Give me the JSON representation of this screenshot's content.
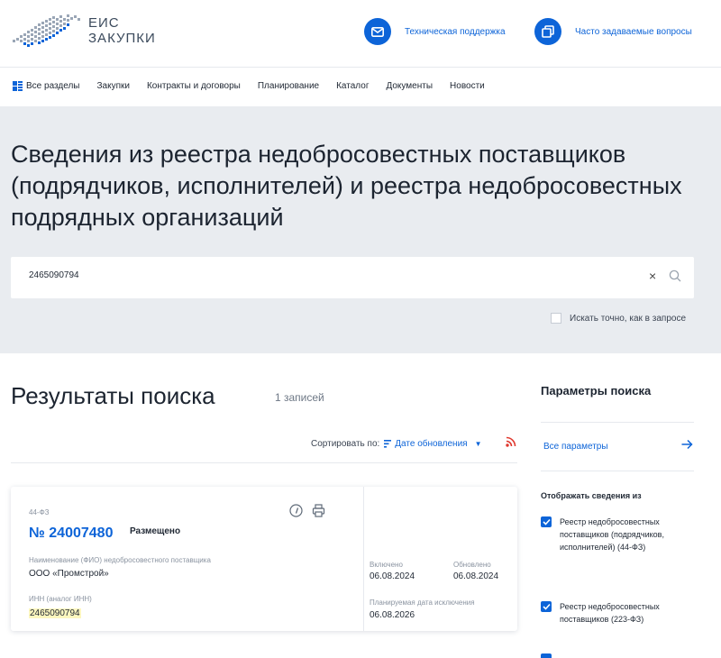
{
  "header": {
    "logo_line1": "ЕИС",
    "logo_line2": "ЗАКУПКИ",
    "support_label": "Техническая поддержка",
    "faq_label": "Часто задаваемые вопросы"
  },
  "nav": {
    "all_sections": "Все разделы",
    "items": [
      "Закупки",
      "Контракты и договоры",
      "Планирование",
      "Каталог",
      "Документы",
      "Новости"
    ]
  },
  "hero": {
    "title": "Сведения из реестра недобросовестных поставщиков (подрядчиков, исполнителей) и реестра недобросовестных подрядных организаций",
    "search_value": "2465090794",
    "exact_label": "Искать точно, как в запросе"
  },
  "results": {
    "title": "Результаты поиска",
    "count": "1 записей",
    "sort_label": "Сортировать по:",
    "sort_value": "Дате обновления"
  },
  "card": {
    "law": "44-ФЗ",
    "number": "№ 24007480",
    "status": "Размещено",
    "supplier_label": "Наименование (ФИО) недобросовестного поставщика",
    "supplier_value": "ООО «Промстрой»",
    "inn_label": "ИНН (аналог ИНН)",
    "inn_value": "2465090794",
    "included_label": "Включено",
    "included_value": "06.08.2024",
    "updated_label": "Обновлено",
    "updated_value": "06.08.2024",
    "planned_label": "Планируемая дата исключения",
    "planned_value": "06.08.2026"
  },
  "panel": {
    "title": "Параметры поиска",
    "all_params": "Все параметры",
    "show_from": "Отображать сведения из",
    "options": [
      "Реестр недобросовестных поставщиков (подрядчиков, исполнителей) (44-ФЗ)",
      "Реестр недобросовестных поставщиков (223-ФЗ)"
    ]
  },
  "colors": {
    "accent": "#0d64d8",
    "hero_bg": "#e9ecf0",
    "highlight": "#fdf7bf",
    "rss": "#e0382e"
  }
}
